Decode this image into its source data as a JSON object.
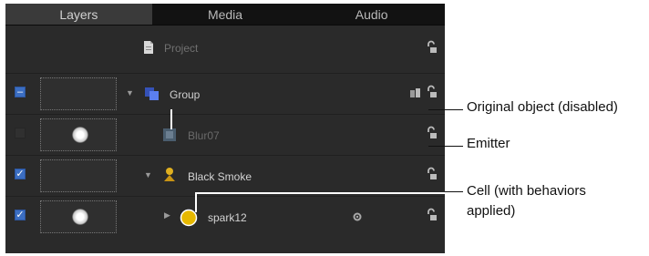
{
  "tabs": [
    {
      "label": "Layers",
      "active": true
    },
    {
      "label": "Media",
      "active": false
    },
    {
      "label": "Audio",
      "active": false
    }
  ],
  "rows": [
    {
      "name": "Project",
      "kind": "project",
      "checkbox": "none",
      "disclosure": "none",
      "state": "dim"
    },
    {
      "name": "Group",
      "kind": "group",
      "checkbox": "mixed",
      "disclosure": "open",
      "state": "normal"
    },
    {
      "name": "Blur07",
      "kind": "emitter",
      "checkbox": "off",
      "disclosure": "none",
      "state": "disabled"
    },
    {
      "name": "Black Smoke",
      "kind": "emitter-active",
      "checkbox": "on",
      "disclosure": "open",
      "state": "normal"
    },
    {
      "name": "spark12",
      "kind": "cell",
      "checkbox": "on",
      "disclosure": "closed",
      "state": "normal"
    }
  ],
  "callouts": [
    {
      "text": "Original object (disabled)"
    },
    {
      "text": "Emitter"
    },
    {
      "text": "Cell (with behaviors\napplied)"
    }
  ],
  "colors": {
    "panel": "#2a2a2a",
    "tab_active": "#3a3a3a",
    "checkbox_on": "#3b6ec2",
    "group_icon": "#4a6fd6",
    "cell_icon": "#e3b400"
  }
}
